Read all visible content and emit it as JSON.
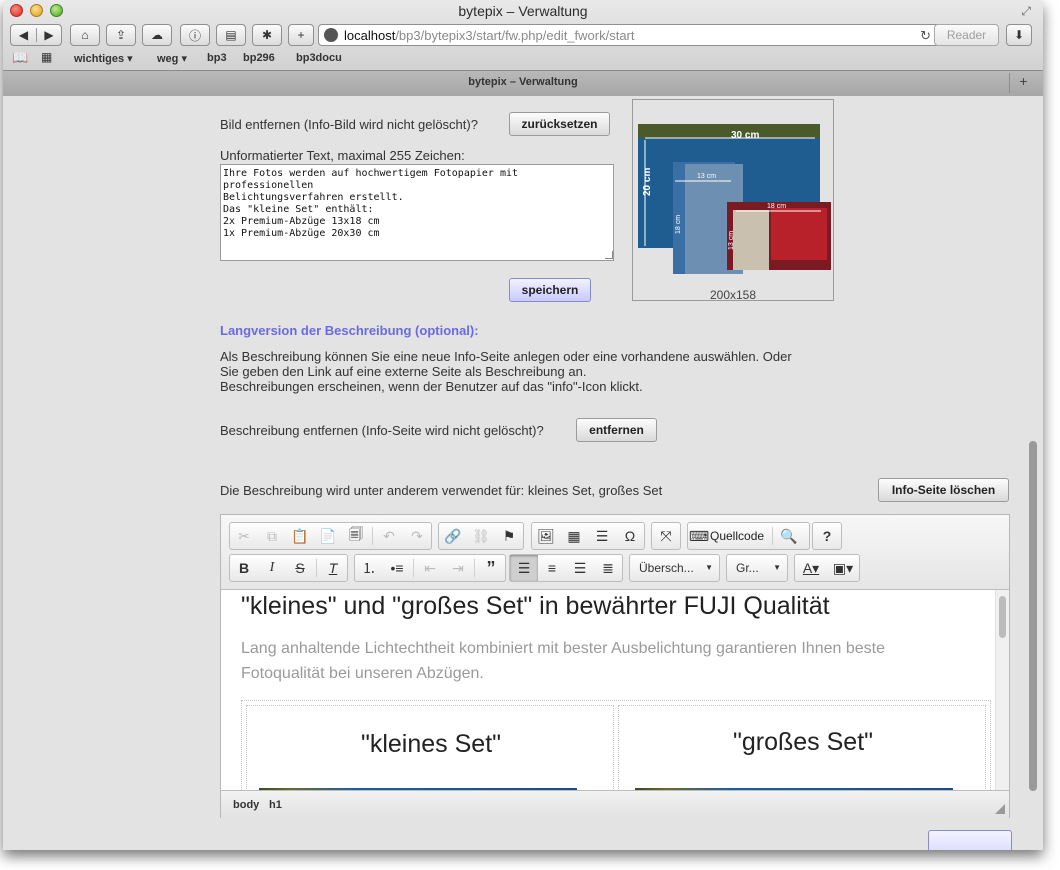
{
  "window": {
    "title": "bytepix – Verwaltung"
  },
  "browser": {
    "url_host": "localhost",
    "url_path": "/bp3/bytepix3/start/fw.php/edit_fwork/start",
    "reader_label": "Reader",
    "bookmarks": [
      "wichtiges ▾",
      "weg ▾",
      "bp3",
      "bp296",
      "bp3docu"
    ],
    "tab_title": "bytepix – Verwaltung"
  },
  "image_section": {
    "remove_label": "Bild entfernen (Info-Bild wird nicht gelöscht)?",
    "reset_button": "zurücksetzen",
    "text_label": "Unformatierter Text, maximal 255 Zeichen:",
    "text_value": "Ihre Fotos werden auf hochwertigem Fotopapier mit professionellen\nBelichtungsverfahren erstellt.\nDas \"kleine Set\" enthält:\n2x Premium-Abzüge 13x18 cm\n1x Premium-Abzüge 20x30 cm",
    "save_button": "speichern",
    "preview_size": "200x158",
    "preview_labels": {
      "width": "30 cm",
      "height": "20 cm",
      "small_w": "13 cm",
      "small_h": "18 cm",
      "small2_w": "18 cm",
      "small2_h": "13 cm"
    }
  },
  "description_section": {
    "heading": "Langversion der Beschreibung (optional):",
    "info_text_1": "Als Beschreibung können Sie eine neue Info-Seite anlegen oder eine vorhandene auswählen. Oder",
    "info_text_2": "Sie geben den Link auf eine externe Seite als Beschreibung an.",
    "info_text_3": "Beschreibungen erscheinen, wenn der Benutzer auf das \"info\"-Icon klickt.",
    "remove_label": "Beschreibung entfernen (Info-Seite wird nicht gelöscht)?",
    "remove_button": "entfernen",
    "usage_text": "Die Beschreibung wird unter anderem verwendet für: kleines Set, großes Set",
    "delete_button": "Info-Seite löschen"
  },
  "editor": {
    "source_label": "Quellcode",
    "help_label": "?",
    "format_combo": "Übersch...",
    "size_combo": "Gr...",
    "content_heading": "\"kleines\" und \"großes Set\" in bewährter FUJI Qualität",
    "content_paragraph": "Lang anhaltende Lichtechtheit kombiniert mit bester Ausbelichtung garantieren Ihnen beste Fotoqualität bei unseren Abzügen.",
    "cell_1_title": "\"kleines Set\"",
    "cell_2_title": "\"großes Set\"",
    "path_items": [
      "body",
      "h1"
    ]
  },
  "colors": {
    "accent_heading": "#6a6ae6",
    "primary_button": "#c8c9ff"
  }
}
